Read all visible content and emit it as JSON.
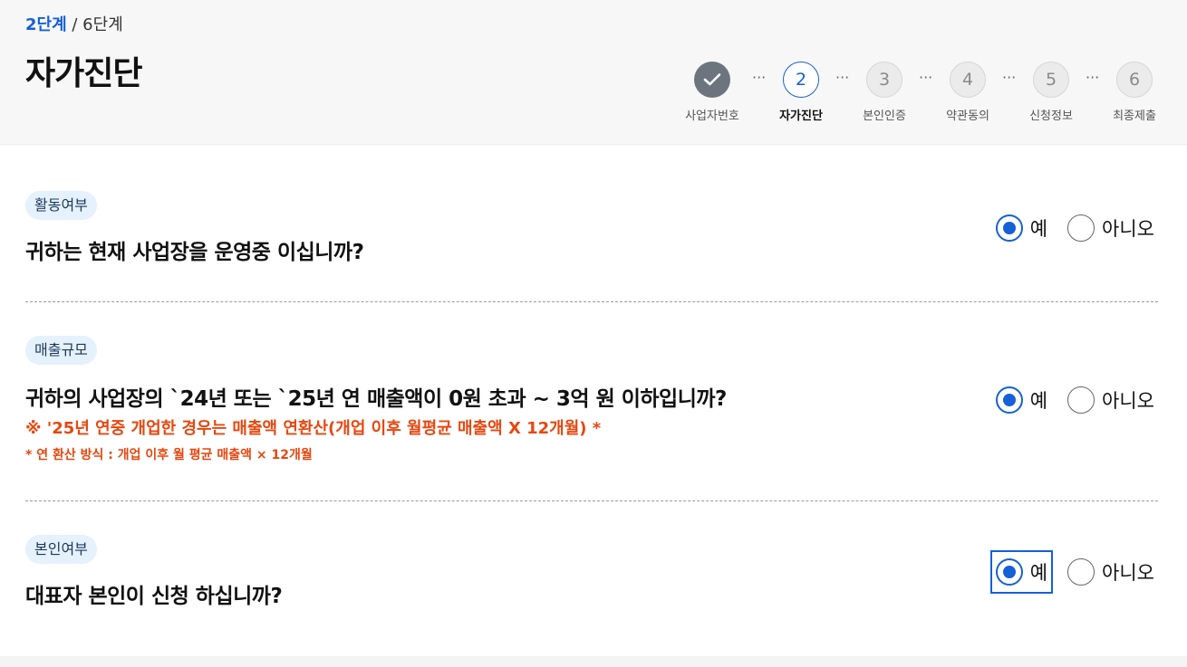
{
  "header": {
    "step_current": "2단계",
    "step_total": "/ 6단계",
    "title": "자가진단"
  },
  "stepper": {
    "steps": [
      {
        "number": "",
        "label": "사업자번호",
        "state": "done",
        "icon": "check-icon"
      },
      {
        "number": "2",
        "label": "자가진단",
        "state": "active"
      },
      {
        "number": "3",
        "label": "본인인증",
        "state": "todo"
      },
      {
        "number": "4",
        "label": "약관동의",
        "state": "todo"
      },
      {
        "number": "5",
        "label": "신청정보",
        "state": "todo"
      },
      {
        "number": "6",
        "label": "최종제출",
        "state": "todo"
      }
    ],
    "separator": "···"
  },
  "questions": [
    {
      "tag": "활동여부",
      "text": "귀하는 현재 사업장을 운영중 이십니까?",
      "options": {
        "yes": "예",
        "no": "아니오"
      },
      "selected": "yes"
    },
    {
      "tag": "매출규모",
      "text": "귀하의 사업장의 `24년 또는 `25년 연 매출액이 0원 초과 ~ 3억 원 이하입니까?",
      "note1": "※ '25년 연중 개업한 경우는 매출액 연환산(개업 이후 월평균 매출액 X 12개월) *",
      "note2": "* 연 환산 방식 : 개업 이후 월 평균 매출액 × 12개월",
      "options": {
        "yes": "예",
        "no": "아니오"
      },
      "selected": "yes"
    },
    {
      "tag": "본인여부",
      "text": "대표자 본인이 신청 하십니까?",
      "options": {
        "yes": "예",
        "no": "아니오"
      },
      "selected": "yes"
    }
  ],
  "colors": {
    "accent": "#1560d8",
    "warning": "#e8470f",
    "tag_bg": "#e5f1fc",
    "header_bg": "#f7f7f7"
  }
}
